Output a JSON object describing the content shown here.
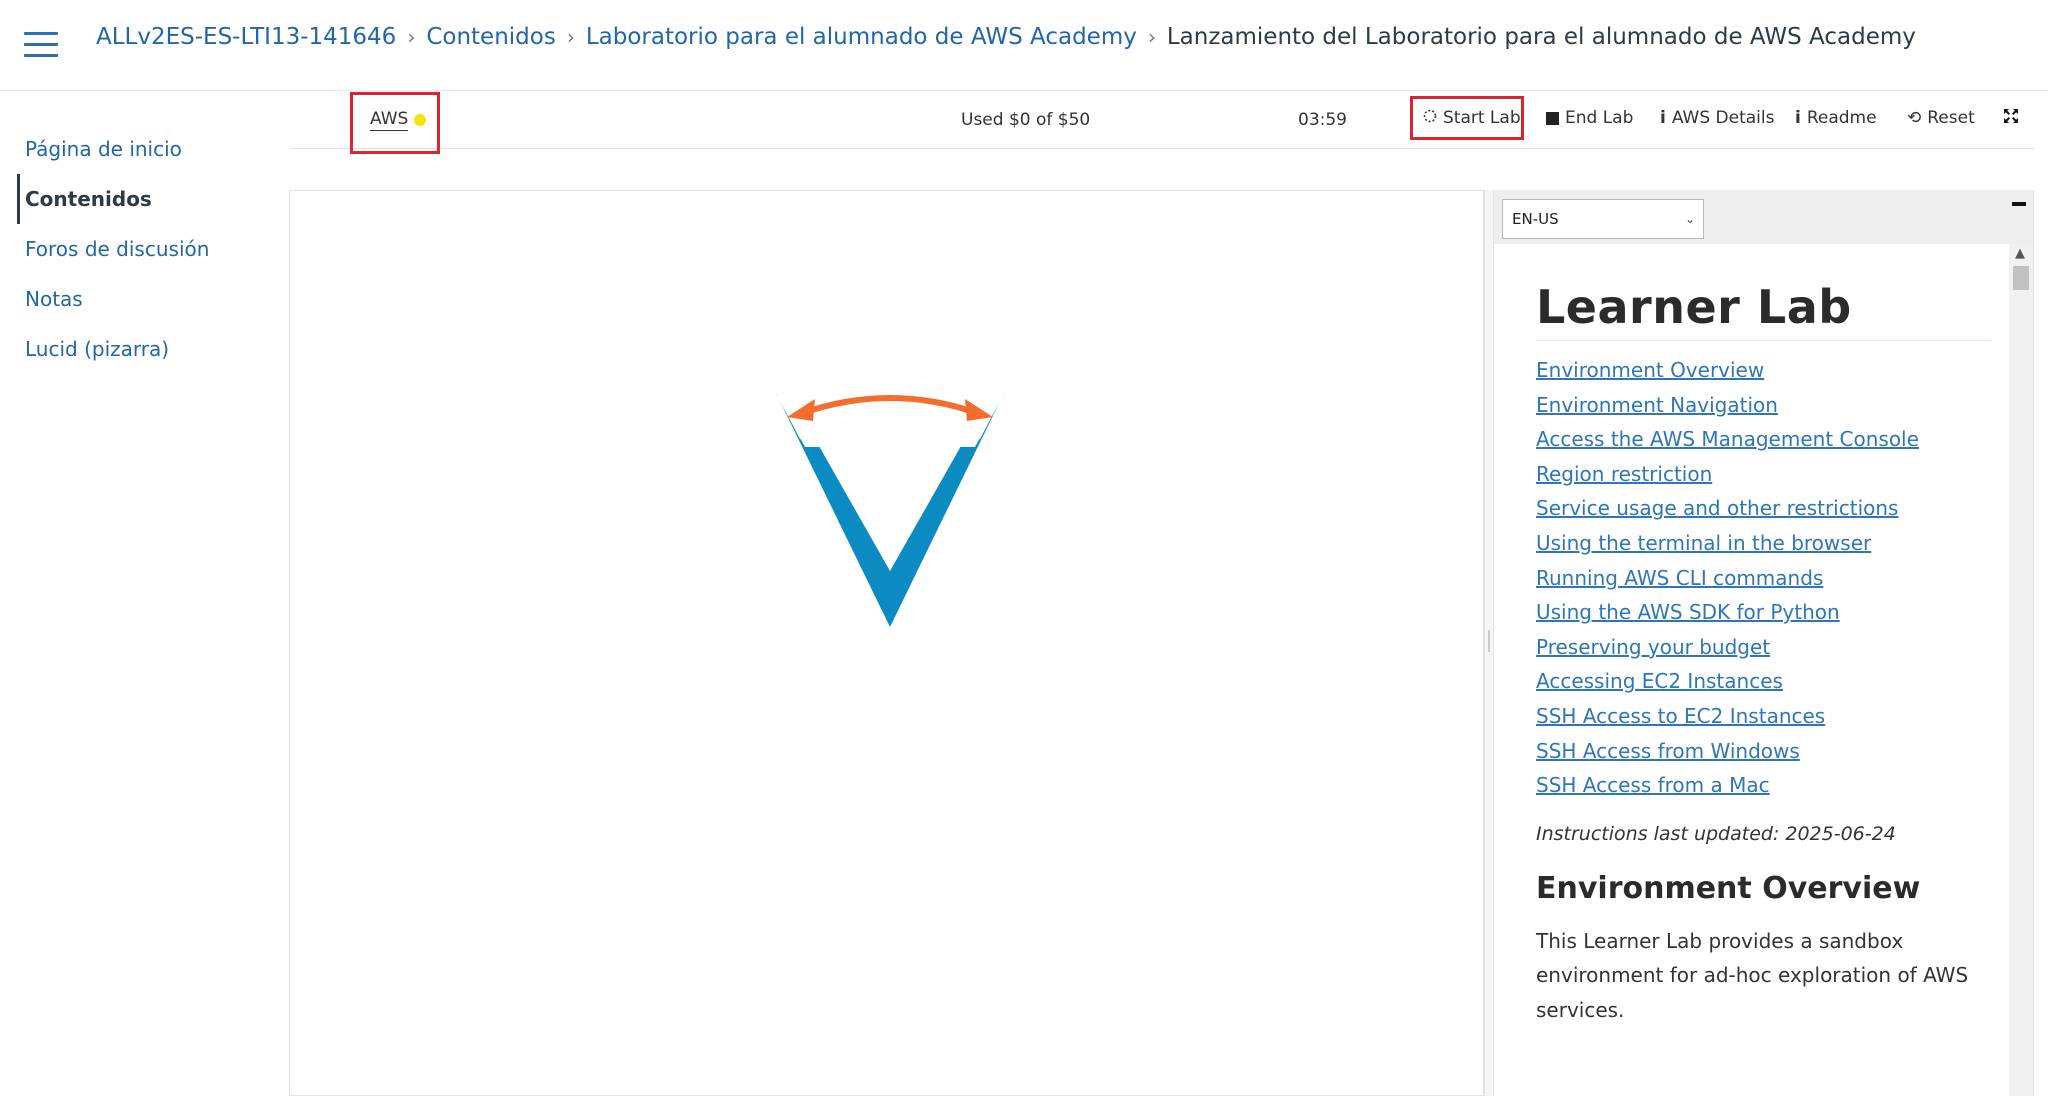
{
  "header": {
    "breadcrumb": [
      "ALLv2ES-ES-LTI13-141646",
      "Contenidos",
      "Laboratorio para el alumnado de AWS Academy"
    ],
    "current_page": "Lanzamiento del Laboratorio para el alumnado de AWS Academy"
  },
  "sidebar": {
    "items": [
      {
        "label": "Página de inicio",
        "active": false
      },
      {
        "label": "Contenidos",
        "active": true
      },
      {
        "label": "Foros de discusión",
        "active": false
      },
      {
        "label": "Notas",
        "active": false
      },
      {
        "label": "Lucid (pizarra)",
        "active": false
      }
    ]
  },
  "toolbar": {
    "aws_label": "AWS",
    "aws_status_color": "#f3e60f",
    "budget": "Used $0 of $50",
    "timer": "03:59",
    "start_lab": "Start Lab",
    "end_lab": "End Lab",
    "aws_details": "AWS Details",
    "readme": "Readme",
    "reset": "Reset",
    "highlight_color": "#d8252f"
  },
  "workspace": {
    "logo_colors": {
      "v": "#0a8bc1",
      "arrow": "#f36e2c"
    }
  },
  "readme": {
    "language": "EN-US",
    "title": "Learner Lab",
    "toc": [
      "Environment Overview",
      "Environment Navigation",
      "Access the AWS Management Console",
      "Region restriction",
      "Service usage and other restrictions",
      "Using the terminal in the browser",
      "Running AWS CLI commands",
      "Using the AWS SDK for Python",
      "Preserving your budget",
      "Accessing EC2 Instances",
      "SSH Access to EC2 Instances",
      "SSH Access from Windows",
      "SSH Access from a Mac"
    ],
    "updated": "Instructions last updated: 2025-06-24",
    "section_title": "Environment Overview",
    "section_text": "This Learner Lab provides a sandbox environment for ad-hoc exploration of AWS services."
  }
}
